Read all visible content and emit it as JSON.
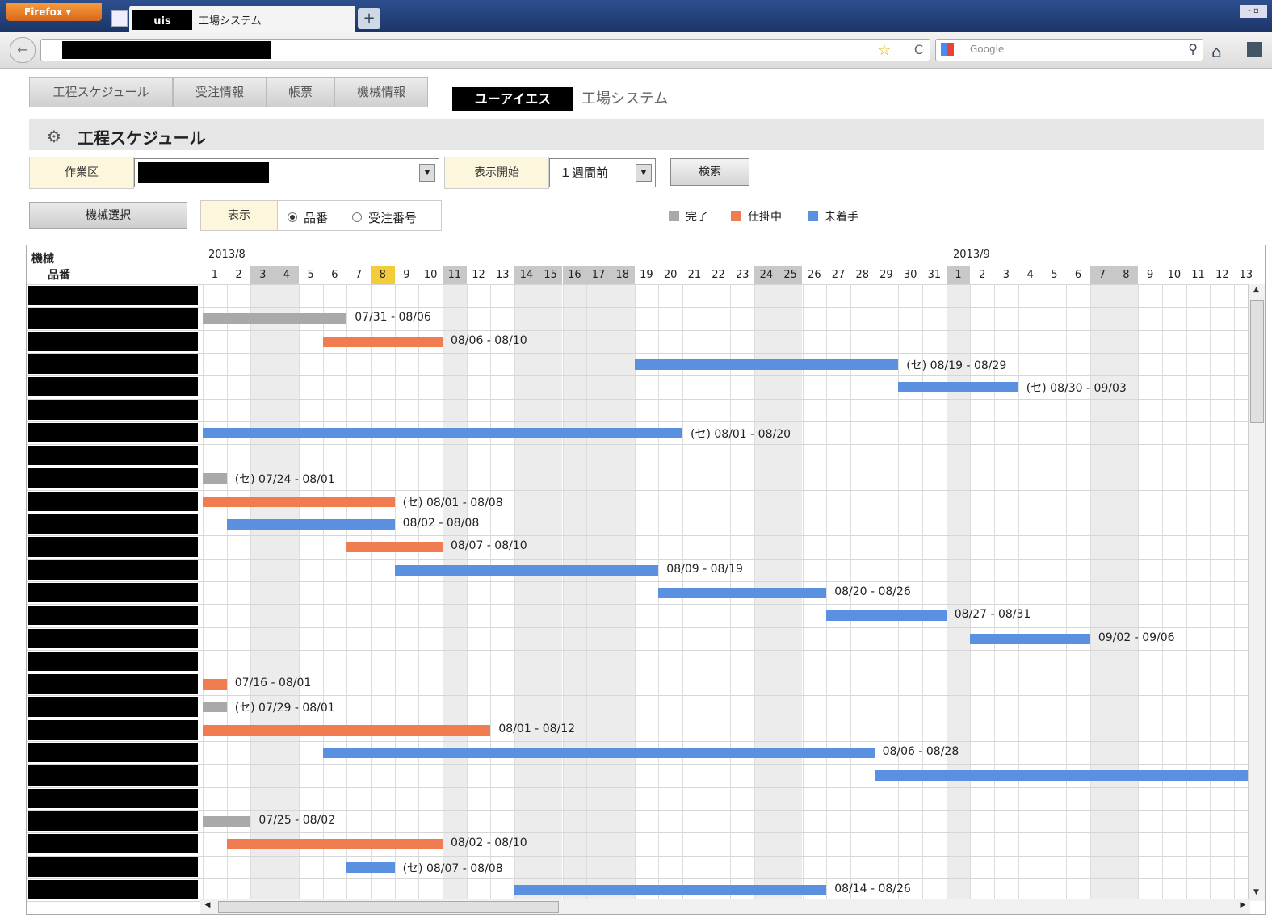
{
  "browser": {
    "menu_button": "Firefox",
    "tab_title": "工場システム",
    "tab_favicon_text": "uis",
    "new_tab_symbol": "+",
    "window_controls": "- ▫",
    "search_placeholder": "Google"
  },
  "nav": {
    "items": [
      "工程スケジュール",
      "受注情報",
      "帳票",
      "機械情報"
    ],
    "brand_name": "ユーアイエス",
    "brand_suffix": "工場システム"
  },
  "page": {
    "title": "工程スケジュール"
  },
  "filters": {
    "workarea_label": "作業区",
    "start_label": "表示開始",
    "start_value": "１週間前",
    "search_button": "検索",
    "machine_select_button": "機械選択",
    "display_label": "表示",
    "radio_options": [
      {
        "label": "品番",
        "checked": true
      },
      {
        "label": "受注番号",
        "checked": false
      }
    ]
  },
  "legend": [
    {
      "label": "完了",
      "color": "#a9a9a9"
    },
    {
      "label": "仕掛中",
      "color": "#f07d50"
    },
    {
      "label": "未着手",
      "color": "#5b8fe0"
    }
  ],
  "gantt": {
    "header_machine": "機械",
    "header_part": "品番",
    "month_1": "2013/8",
    "month_2": "2013/9",
    "days": [
      {
        "d": "1",
        "t": "n"
      },
      {
        "d": "2",
        "t": "n"
      },
      {
        "d": "3",
        "t": "w"
      },
      {
        "d": "4",
        "t": "w"
      },
      {
        "d": "5",
        "t": "n"
      },
      {
        "d": "6",
        "t": "n"
      },
      {
        "d": "7",
        "t": "n"
      },
      {
        "d": "8",
        "t": "today"
      },
      {
        "d": "9",
        "t": "n"
      },
      {
        "d": "10",
        "t": "n"
      },
      {
        "d": "11",
        "t": "w"
      },
      {
        "d": "12",
        "t": "n"
      },
      {
        "d": "13",
        "t": "n"
      },
      {
        "d": "14",
        "t": "w"
      },
      {
        "d": "15",
        "t": "w"
      },
      {
        "d": "16",
        "t": "w"
      },
      {
        "d": "17",
        "t": "w"
      },
      {
        "d": "18",
        "t": "w"
      },
      {
        "d": "19",
        "t": "n"
      },
      {
        "d": "20",
        "t": "n"
      },
      {
        "d": "21",
        "t": "n"
      },
      {
        "d": "22",
        "t": "n"
      },
      {
        "d": "23",
        "t": "n"
      },
      {
        "d": "24",
        "t": "w"
      },
      {
        "d": "25",
        "t": "w"
      },
      {
        "d": "26",
        "t": "n"
      },
      {
        "d": "27",
        "t": "n"
      },
      {
        "d": "28",
        "t": "n"
      },
      {
        "d": "29",
        "t": "n"
      },
      {
        "d": "30",
        "t": "n"
      },
      {
        "d": "31",
        "t": "n"
      },
      {
        "d": "1",
        "t": "w"
      },
      {
        "d": "2",
        "t": "n"
      },
      {
        "d": "3",
        "t": "n"
      },
      {
        "d": "4",
        "t": "n"
      },
      {
        "d": "5",
        "t": "n"
      },
      {
        "d": "6",
        "t": "n"
      },
      {
        "d": "7",
        "t": "w"
      },
      {
        "d": "8",
        "t": "w"
      },
      {
        "d": "9",
        "t": "n"
      },
      {
        "d": "10",
        "t": "n"
      },
      {
        "d": "11",
        "t": "n"
      },
      {
        "d": "12",
        "t": "n"
      },
      {
        "d": "13",
        "t": "n"
      }
    ],
    "tasks": [
      {
        "row": 1,
        "start": 0,
        "end": 6,
        "status": "done",
        "label": "07/31 - 08/06"
      },
      {
        "row": 2,
        "start": 5,
        "end": 10,
        "status": "wip",
        "label": "08/06 - 08/10"
      },
      {
        "row": 3,
        "start": 18,
        "end": 29,
        "status": "todo",
        "label": "(セ) 08/19 - 08/29"
      },
      {
        "row": 4,
        "start": 29,
        "end": 34,
        "status": "todo",
        "label": "(セ) 08/30 - 09/03"
      },
      {
        "row": 6,
        "start": 0,
        "end": 20,
        "status": "todo",
        "label": "(セ) 08/01 - 08/20"
      },
      {
        "row": 8,
        "start": 0,
        "end": 1,
        "status": "done",
        "label": "(セ) 07/24 - 08/01"
      },
      {
        "row": 9,
        "start": 0,
        "end": 8,
        "status": "wip",
        "label": "(セ) 08/01 - 08/08"
      },
      {
        "row": 10,
        "start": 1,
        "end": 8,
        "status": "todo",
        "label": "08/02 - 08/08"
      },
      {
        "row": 11,
        "start": 6,
        "end": 10,
        "status": "wip",
        "label": "08/07 - 08/10"
      },
      {
        "row": 12,
        "start": 8,
        "end": 19,
        "status": "todo",
        "label": "08/09 - 08/19"
      },
      {
        "row": 13,
        "start": 19,
        "end": 26,
        "status": "todo",
        "label": "08/20 - 08/26"
      },
      {
        "row": 14,
        "start": 26,
        "end": 31,
        "status": "todo",
        "label": "08/27 - 08/31"
      },
      {
        "row": 15,
        "start": 32,
        "end": 37,
        "status": "todo",
        "label": "09/02 - 09/06"
      },
      {
        "row": 17,
        "start": 0,
        "end": 1,
        "status": "wip",
        "label": "07/16 - 08/01"
      },
      {
        "row": 18,
        "start": 0,
        "end": 1,
        "status": "done",
        "label": "(セ) 07/29 - 08/01"
      },
      {
        "row": 19,
        "start": 0,
        "end": 12,
        "status": "wip",
        "label": "08/01 - 08/12"
      },
      {
        "row": 20,
        "start": 5,
        "end": 28,
        "status": "todo",
        "label": "08/06 - 08/28"
      },
      {
        "row": 21,
        "start": 28,
        "end": 44,
        "status": "todo",
        "label": ""
      },
      {
        "row": 23,
        "start": 0,
        "end": 2,
        "status": "done",
        "label": "07/25 - 08/02"
      },
      {
        "row": 24,
        "start": 1,
        "end": 10,
        "status": "wip",
        "label": "08/02 - 08/10"
      },
      {
        "row": 25,
        "start": 6,
        "end": 8,
        "status": "todo",
        "label": "(セ) 08/07 - 08/08"
      },
      {
        "row": 26,
        "start": 13,
        "end": 26,
        "status": "todo",
        "label": "08/14 - 08/26"
      }
    ]
  }
}
